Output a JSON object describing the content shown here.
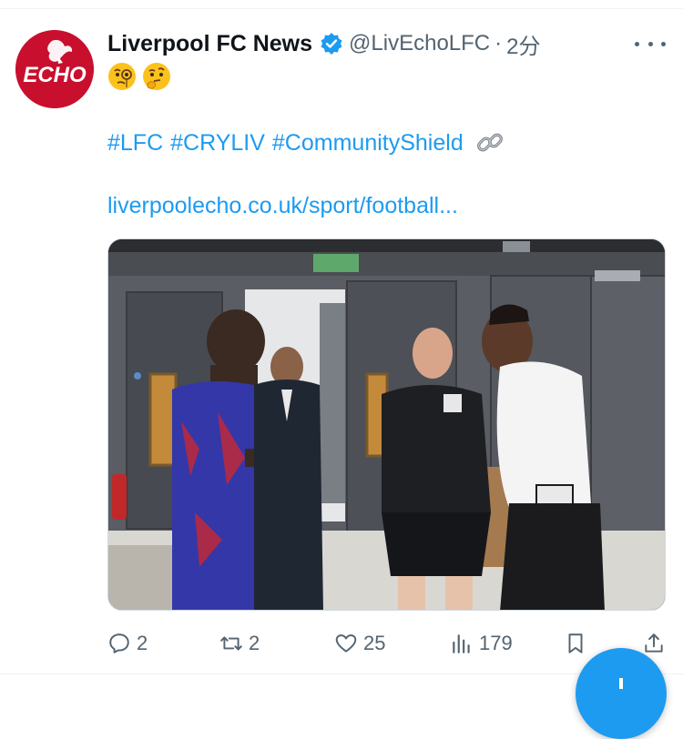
{
  "tweet": {
    "display_name": "Liverpool FC News",
    "handle": "@LivEchoLFC",
    "separator": "·",
    "time": "2分",
    "avatar_text": "ECHO",
    "emojis": [
      "face-with-monocle-emoji",
      "thinking-face-emoji"
    ],
    "hashtags": [
      "#LFC",
      "#CRYLIV",
      "#CommunityShield"
    ],
    "link_emoji": "link-emoji",
    "url": "liverpoolecho.co.uk/sport/football..."
  },
  "actions": {
    "reply_count": "2",
    "retweet_count": "2",
    "like_count": "25",
    "views_count": "179"
  },
  "colors": {
    "accent": "#1d9bf0",
    "secondary_text": "#536471",
    "brand_red": "#c8102e"
  }
}
